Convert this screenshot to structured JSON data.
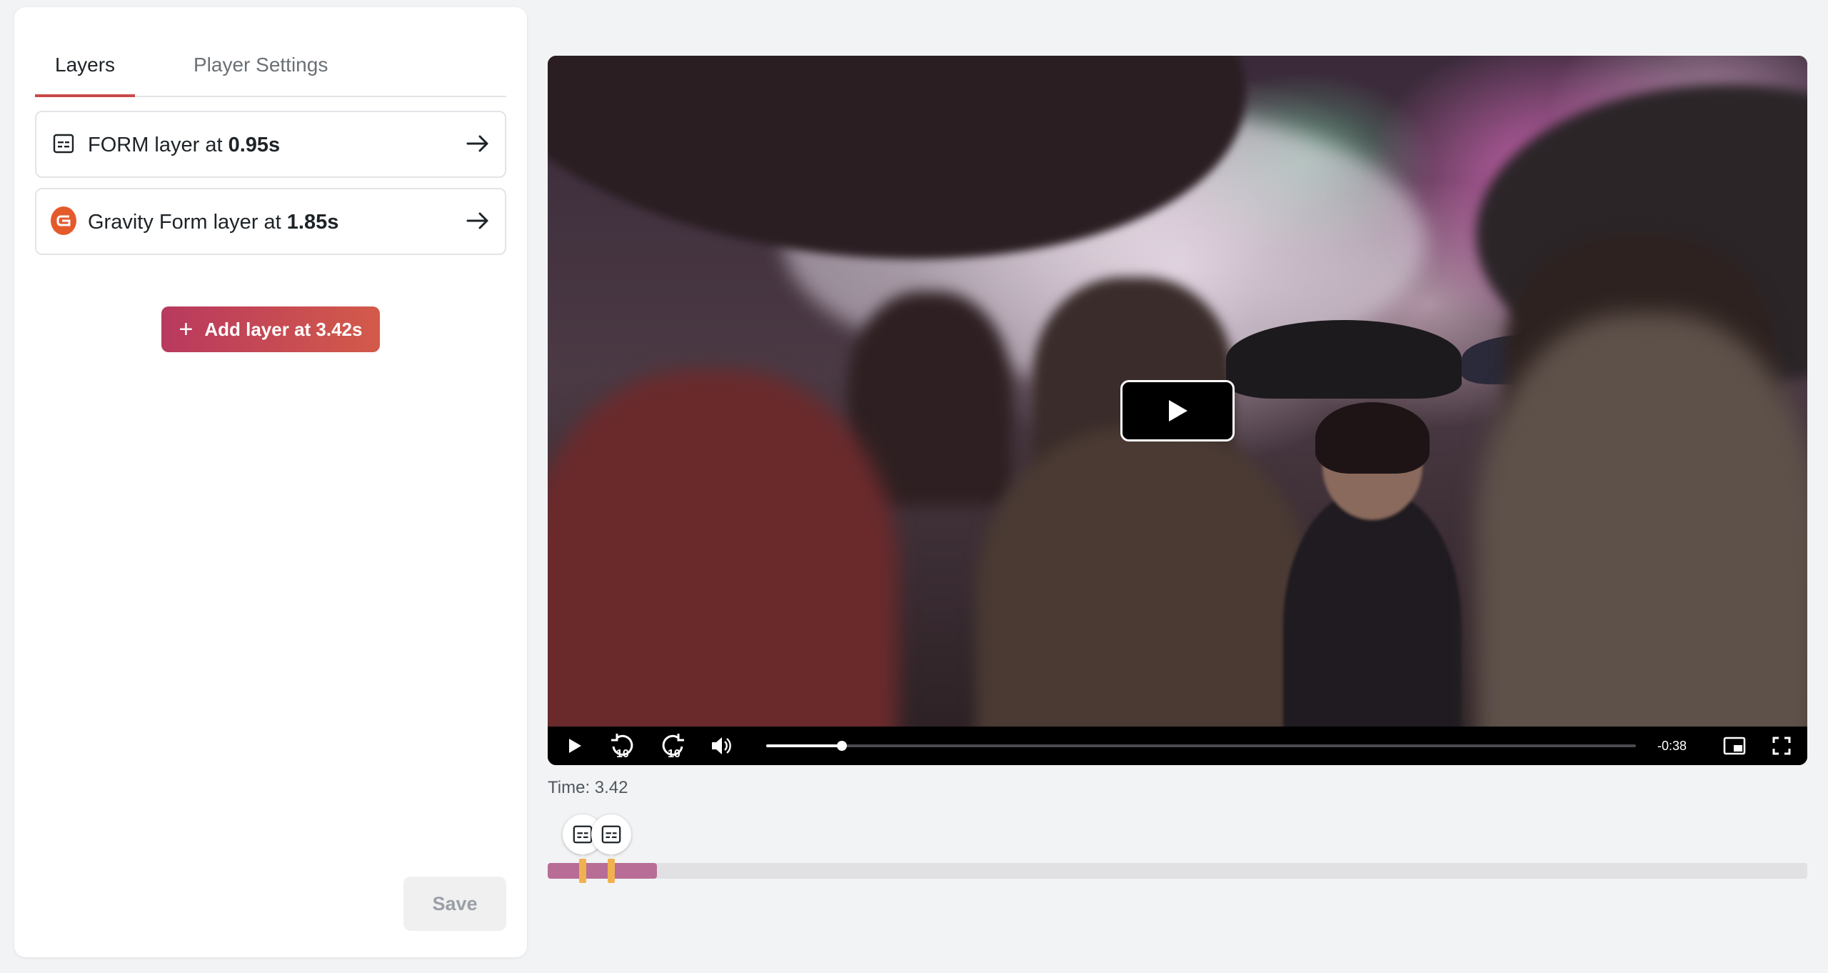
{
  "tabs": [
    {
      "label": "Layers",
      "active": true
    },
    {
      "label": "Player Settings",
      "active": false
    }
  ],
  "layers": [
    {
      "prefix": "FORM layer at ",
      "time": "0.95s",
      "icon": "form-icon"
    },
    {
      "prefix": "Gravity Form layer at ",
      "time": "1.85s",
      "icon": "gravity-forms-icon"
    }
  ],
  "add_layer_label": "Add layer at 3.42s",
  "save_label": "Save",
  "player": {
    "remaining": "-0:38",
    "progress_fraction": 0.087,
    "play_icon": "play-icon",
    "accent_color": "#ffffff"
  },
  "timeline": {
    "time_label": "Time: 3.42",
    "fill_fraction": 0.087,
    "fill_color": "#b86d96",
    "marker_color": "#f0b24e",
    "markers": [
      {
        "time": 0.95,
        "icon": "form-icon"
      },
      {
        "time": 1.85,
        "icon": "form-icon"
      }
    ]
  },
  "colors": {
    "accent": "#c94a4a",
    "add_button_start": "#b8395e",
    "add_button_end": "#d35a4a",
    "gravity_badge": "#e55a2b"
  }
}
